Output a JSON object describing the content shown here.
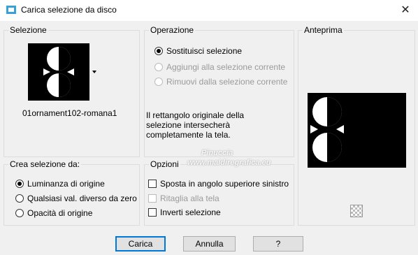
{
  "window": {
    "title": "Carica selezione da disco",
    "close_glyph": "✕"
  },
  "selezione": {
    "legend": "Selezione",
    "file_name": "01ornament102-romana1"
  },
  "operazione": {
    "legend": "Operazione",
    "options": [
      "Sostituisci selezione",
      "Aggiungi alla selezione corrente",
      "Rimuovi dalla selezione corrente"
    ],
    "description": [
      "Il rettangolo originale della",
      "selezione intersecherà",
      "completamente la tela."
    ]
  },
  "anteprima": {
    "legend": "Anteprima"
  },
  "crea": {
    "legend": "Crea selezione da:",
    "options": [
      "Luminanza di origine",
      "Qualsiasi val. diverso da zero",
      "Opacità di origine"
    ]
  },
  "opzioni": {
    "legend": "Opzioni",
    "items": [
      "Sposta in angolo superiore sinistro",
      "Ritaglia alla tela",
      "Inverti selezione"
    ]
  },
  "buttons": {
    "ok": "Carica",
    "cancel": "Annulla",
    "help": "?"
  },
  "watermark": {
    "line1": "Pinuccia",
    "line2": "www.maldiregrafica.eu"
  }
}
